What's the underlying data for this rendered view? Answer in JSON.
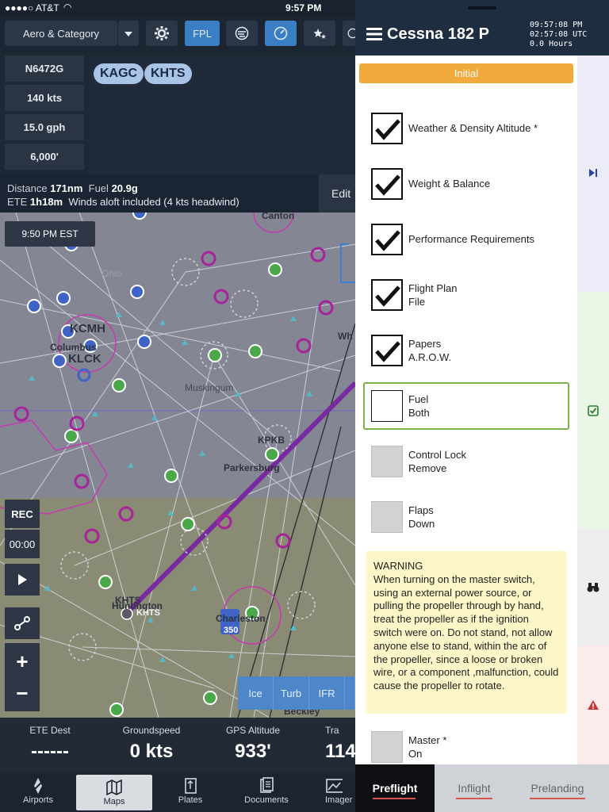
{
  "status": {
    "carrier": "●●●●○ AT&T",
    "time": "9:57 PM"
  },
  "toolbar": {
    "aero_label": "Aero & Category",
    "fpl_label": "FPL",
    "icons": [
      "settings-gear-icon",
      "dropdown-arrow-icon",
      "layers-icon",
      "gauge-icon",
      "stars-icon"
    ]
  },
  "flightplan": {
    "tail": "N6472G",
    "speed": "140 kts",
    "fuel_flow": "15.0 gph",
    "altitude": "6,000'",
    "waypoints": [
      "KAGC",
      "KHTS"
    ]
  },
  "route": {
    "distance_label": "Distance",
    "distance": "171nm",
    "fuel_label": "Fuel",
    "fuel": "20.9g",
    "ete_label": "ETE",
    "ete": "1h18m",
    "winds": "Winds aloft included (4 kts headwind)",
    "edit_label": "Edit"
  },
  "map": {
    "time_chip": "9:50 PM EST",
    "labels": {
      "canton": "Canton",
      "ohio": "Ohio",
      "kcmh": "KCMH",
      "columbus": "Columbus",
      "klck": "KLCK",
      "muskingum": "Muskingum",
      "kpkb": "KPKB",
      "parkersburg": "Parkersburg",
      "khts_top": "KHTS",
      "huntington": "Huntington",
      "khts_bottom": "KHTS",
      "charleston": "Charleston",
      "beckley": "Beckley",
      "wh": "Wh",
      "rwy": "350"
    },
    "controls": {
      "rec": "REC",
      "timer": "00:00"
    },
    "weather_buttons": [
      "Ice",
      "Turb",
      "IFR"
    ]
  },
  "instruments": [
    {
      "label": "ETE Dest",
      "value": "------"
    },
    {
      "label": "Groundspeed",
      "value": "0 kts"
    },
    {
      "label": "GPS Altitude",
      "value": "933'"
    },
    {
      "label": "Tra",
      "value": "114"
    }
  ],
  "tabs": [
    {
      "label": "Airports",
      "icon": "airport-compass-icon"
    },
    {
      "label": "Maps",
      "icon": "map-icon"
    },
    {
      "label": "Plates",
      "icon": "plates-icon"
    },
    {
      "label": "Documents",
      "icon": "documents-icon"
    },
    {
      "label": "Imager",
      "icon": "imagery-icon"
    }
  ],
  "checklist": {
    "title": "Cessna 182 P",
    "clock_local": "09:57:08 PM",
    "clock_utc": "02:57:08 UTC",
    "hours": "0.0 Hours",
    "section": "Initial",
    "items": [
      {
        "title": "Weather & Density Altitude *",
        "sub": "",
        "state": "checked"
      },
      {
        "title": "Weight & Balance",
        "sub": "",
        "state": "checked"
      },
      {
        "title": "Performance Requirements",
        "sub": "",
        "state": "checked"
      },
      {
        "title": "Flight Plan",
        "sub": "File",
        "state": "checked"
      },
      {
        "title": "Papers",
        "sub": "A.R.O.W.",
        "state": "checked"
      },
      {
        "title": "Fuel",
        "sub": "Both",
        "state": "current"
      },
      {
        "title": "Control Lock",
        "sub": "Remove",
        "state": "pending"
      },
      {
        "title": "Flaps",
        "sub": "Down",
        "state": "pending"
      }
    ],
    "warning": "WARNING\nWhen turning on the master switch, using an external power source, or pulling the propeller through by hand, treat the propeller as if the ignition switch were on. Do not stand, not allow anyone else to stand, within the arc of the propeller, since a loose or broken wire, or a component ,malfunction, could cause the propeller to rotate.",
    "last_item": {
      "title": "Master *",
      "sub": "On",
      "state": "pending"
    },
    "phase_tabs": [
      "Preflight",
      "Inflight",
      "Prelanding"
    ],
    "active_phase": "Preflight",
    "rail_colors": {
      "normal": "#ececf8",
      "checked": "#eaf6e6",
      "info": "#eeeeee",
      "warning": "#fcebeb"
    }
  }
}
